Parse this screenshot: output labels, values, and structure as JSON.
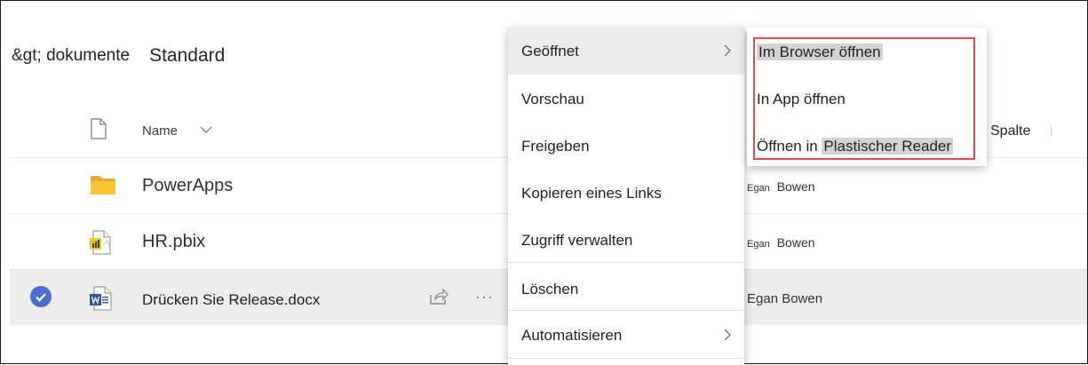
{
  "header": {
    "breadcrumb": "&gt; dokumente",
    "view_name": "Standard"
  },
  "columns": {
    "name": "Name",
    "extra": "Spalte"
  },
  "icons": {
    "header_file": "document-icon",
    "folder": "folder-icon",
    "pbix": "powerbi-file-icon",
    "docx": "word-file-icon",
    "check": "checkmark-circle-icon",
    "share": "share-icon",
    "more": "more-icon",
    "submenu_arrow": "chevron-right-icon"
  },
  "rows": [
    {
      "name": "PowerApps",
      "modified_first": "Egan",
      "modified_last": "Bowen"
    },
    {
      "name": "HR.pbix",
      "modified_first": "Egan",
      "modified_last": "Bowen"
    },
    {
      "name": "Drücken Sie Release.docx",
      "modified_by": "Egan Bowen",
      "selected": true
    }
  ],
  "context_menu": {
    "items": [
      {
        "label": "Geöffnet",
        "has_submenu": true,
        "active": true
      },
      {
        "label": "Vorschau"
      },
      {
        "label": "Freigeben"
      },
      {
        "label": "Kopieren eines Links"
      },
      {
        "label": "Zugriff verwalten"
      },
      {
        "label": "Löschen"
      },
      {
        "label": "Automatisieren",
        "has_submenu": true
      }
    ]
  },
  "submenu": {
    "items": [
      {
        "label": "Im Browser öffnen"
      },
      {
        "label": "In App öffnen"
      },
      {
        "label_prefix": "Öffnen in",
        "label_highlight": "Plastischer Reader"
      }
    ]
  },
  "colors": {
    "accent": "#4a6ed0",
    "highlight_box": "#e04b4b",
    "selected_row": "#ededed",
    "folder": "#f8c433",
    "word": "#2b579a",
    "powerbi": "#f2c811"
  }
}
